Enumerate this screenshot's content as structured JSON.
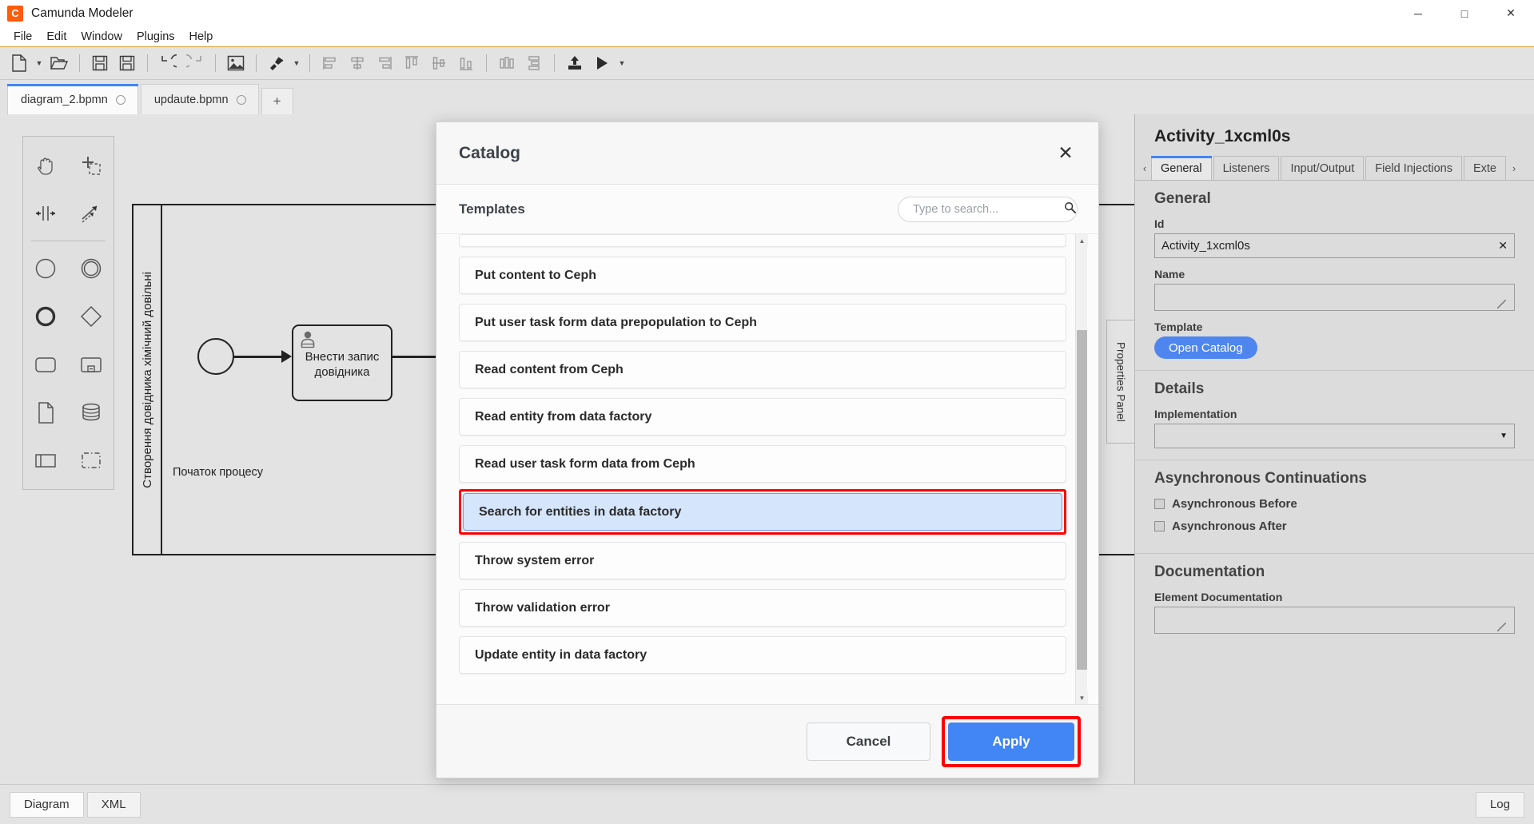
{
  "window": {
    "app_icon": "camunda-logo-icon",
    "title": "Camunda Modeler",
    "minimize": "─",
    "maximize": "□",
    "close": "✕"
  },
  "menubar": {
    "items": [
      "File",
      "Edit",
      "Window",
      "Plugins",
      "Help"
    ]
  },
  "toolbar": {
    "groups": [
      [
        {
          "name": "new-file-icon",
          "caret": true
        },
        {
          "name": "open-file-icon",
          "caret": false
        }
      ],
      [
        {
          "name": "save-icon",
          "caret": false
        },
        {
          "name": "save-as-icon",
          "caret": false
        }
      ],
      [
        {
          "name": "undo-icon",
          "caret": false
        },
        {
          "name": "redo-icon",
          "caret": false
        }
      ],
      [
        {
          "name": "export-image-icon",
          "caret": false
        }
      ],
      [
        {
          "name": "align-tool-icon",
          "caret": true
        }
      ],
      [
        {
          "name": "align-left-icon",
          "caret": false
        },
        {
          "name": "align-center-icon",
          "caret": false
        },
        {
          "name": "align-right-icon",
          "caret": false
        },
        {
          "name": "align-top-icon",
          "caret": false
        },
        {
          "name": "align-middle-icon",
          "caret": false
        },
        {
          "name": "align-bottom-icon",
          "caret": false
        }
      ],
      [
        {
          "name": "distribute-horizontal-icon",
          "caret": false
        },
        {
          "name": "distribute-vertical-icon",
          "caret": false
        }
      ],
      [
        {
          "name": "deploy-icon",
          "caret": false
        },
        {
          "name": "start-process-icon",
          "caret": true
        }
      ]
    ]
  },
  "tabs": {
    "items": [
      {
        "label": "diagram_2.bpmn",
        "active": true
      },
      {
        "label": "updaute.bpmn",
        "active": false
      }
    ],
    "add_label": "+"
  },
  "palette": {
    "rows": [
      [
        "hand-tool-icon",
        "lasso-tool-icon"
      ],
      [
        "space-tool-icon",
        "connect-tool-icon"
      ],
      [
        "start-event-icon",
        "intermediate-event-icon"
      ],
      [
        "end-event-icon",
        "gateway-icon"
      ],
      [
        "task-icon",
        "subprocess-collapsed-icon"
      ],
      [
        "data-object-icon",
        "data-store-icon"
      ],
      [
        "participant-icon",
        "group-icon"
      ]
    ]
  },
  "diagram": {
    "pool_label": "Створення довідника хімічний довільні",
    "start_event_label": "Початок процесу",
    "task_label_line1": "Внести запис",
    "task_label_line2": "довідника",
    "task_type_icon": "user-task-icon"
  },
  "properties_panel": {
    "collapsed_tab_label": "Properties Panel",
    "element_title": "Activity_1xcml0s",
    "tabs": [
      {
        "label": "General",
        "active": true
      },
      {
        "label": "Listeners",
        "active": false
      },
      {
        "label": "Input/Output",
        "active": false
      },
      {
        "label": "Field Injections",
        "active": false
      },
      {
        "label": "Exte",
        "active": false
      }
    ],
    "tab_prev_icon": "‹",
    "tab_next_icon": "›",
    "general": {
      "heading": "General",
      "id_label": "Id",
      "id_value": "Activity_1xcml0s",
      "id_clear_icon": "✕",
      "name_label": "Name",
      "name_value": "",
      "template_label": "Template",
      "open_catalog_button": "Open Catalog"
    },
    "details": {
      "heading": "Details",
      "implementation_label": "Implementation",
      "implementation_value": "",
      "implementation_caret": "▼"
    },
    "async": {
      "heading": "Asynchronous Continuations",
      "items": [
        {
          "label": "Asynchronous Before",
          "checked": false
        },
        {
          "label": "Asynchronous After",
          "checked": false
        }
      ]
    },
    "documentation": {
      "heading": "Documentation",
      "element_documentation_label": "Element Documentation",
      "element_documentation_value": ""
    }
  },
  "catalog_modal": {
    "title": "Catalog",
    "close_icon": "✕",
    "section_title": "Templates",
    "search": {
      "placeholder": "Type to search...",
      "value": "",
      "icon": "search-icon"
    },
    "templates": [
      {
        "label": "Put content to Ceph",
        "selected": false,
        "partial": false
      },
      {
        "label": "Put user task form data prepopulation to Ceph",
        "selected": false,
        "partial": false
      },
      {
        "label": "Read content from Ceph",
        "selected": false,
        "partial": false
      },
      {
        "label": "Read entity from data factory",
        "selected": false,
        "partial": false
      },
      {
        "label": "Read user task form data from Ceph",
        "selected": false,
        "partial": false
      },
      {
        "label": "Search for entities in data factory",
        "selected": true,
        "partial": false
      },
      {
        "label": "Throw system error",
        "selected": false,
        "partial": false
      },
      {
        "label": "Throw validation error",
        "selected": false,
        "partial": false
      },
      {
        "label": "Update entity in data factory",
        "selected": false,
        "partial": false
      }
    ],
    "scroll_up_icon": "▲",
    "scroll_down_icon": "▼",
    "cancel_button": "Cancel",
    "apply_button": "Apply",
    "highlight_color": "#ff0000"
  },
  "statusbar": {
    "tabs": [
      {
        "label": "Diagram",
        "active": true
      },
      {
        "label": "XML",
        "active": false
      }
    ],
    "log_button": "Log"
  }
}
